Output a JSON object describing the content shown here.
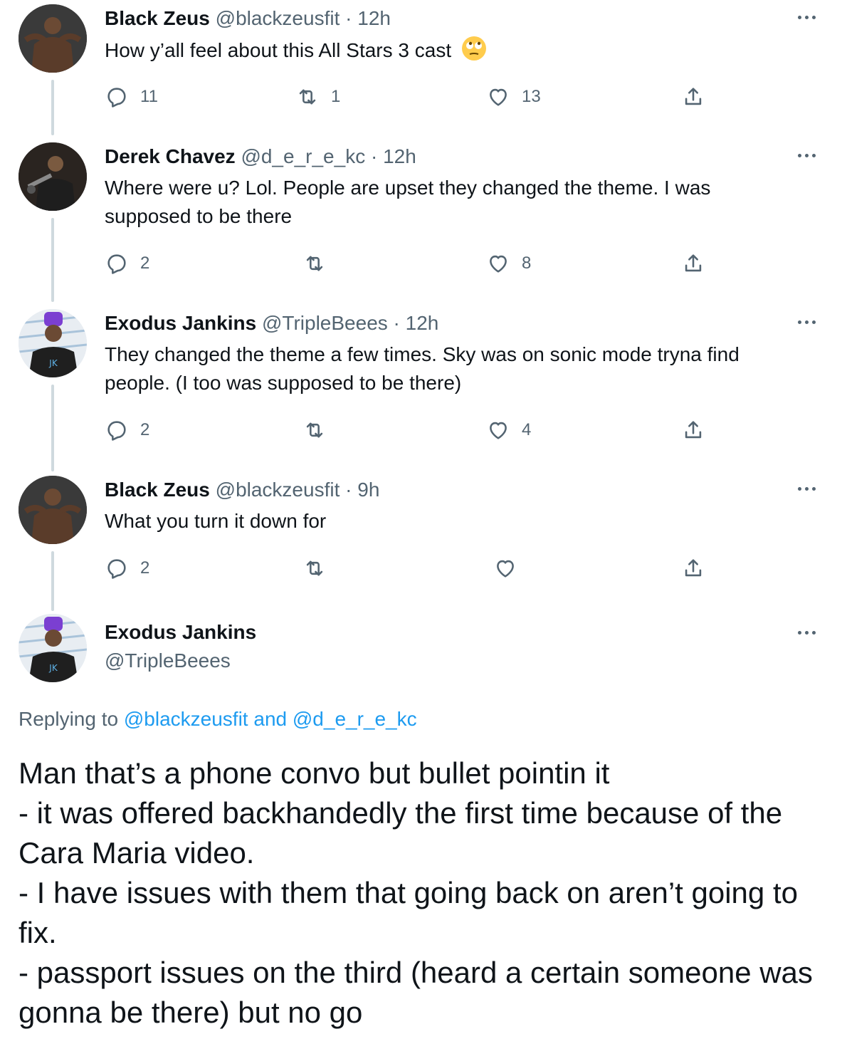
{
  "tweets": [
    {
      "name": "Black Zeus",
      "handle": "@blackzeusfit",
      "dot": "·",
      "time": "12h",
      "text": "How y’all feel about this All Stars 3 cast",
      "emoji": "face-with-rolling-eyes",
      "reply_count": "11",
      "retweet_count": "1",
      "like_count": "13"
    },
    {
      "name": "Derek Chavez",
      "handle": "@d_e_r_e_kc",
      "dot": "·",
      "time": "12h",
      "text": "Where were u? Lol. People are upset they changed the theme. I was supposed to be there",
      "reply_count": "2",
      "retweet_count": "",
      "like_count": "8"
    },
    {
      "name": "Exodus Jankins",
      "handle": "@TripleBeees",
      "dot": "·",
      "time": "12h",
      "text": "They changed the theme a few times. Sky was on sonic mode tryna find people. (I too was supposed to be there)",
      "reply_count": "2",
      "retweet_count": "",
      "like_count": "4"
    },
    {
      "name": "Black Zeus",
      "handle": "@blackzeusfit",
      "dot": "·",
      "time": "9h",
      "text": "What you turn it down for",
      "reply_count": "2",
      "retweet_count": "",
      "like_count": ""
    }
  ],
  "main_tweet": {
    "name": "Exodus Jankins",
    "handle": "@TripleBeees",
    "replying_prefix": "Replying to",
    "replying_user1": "@blackzeusfit",
    "replying_and": "and",
    "replying_user2": "@d_e_r_e_kc",
    "text": "Man that’s a phone convo but bullet pointin it\n- it was offered backhandedly the first time because of the Cara Maria video.\n- I have issues with them that going back on aren’t going to fix.\n- passport issues on the third (heard a certain someone was gonna be there) but no go"
  },
  "colors": {
    "text": "#0f1419",
    "secondary": "#536471",
    "link": "#1d9bf0",
    "thread_line": "#cfd9de"
  },
  "icons": [
    "reply-icon",
    "retweet-icon",
    "like-icon",
    "share-icon",
    "more-icon"
  ]
}
